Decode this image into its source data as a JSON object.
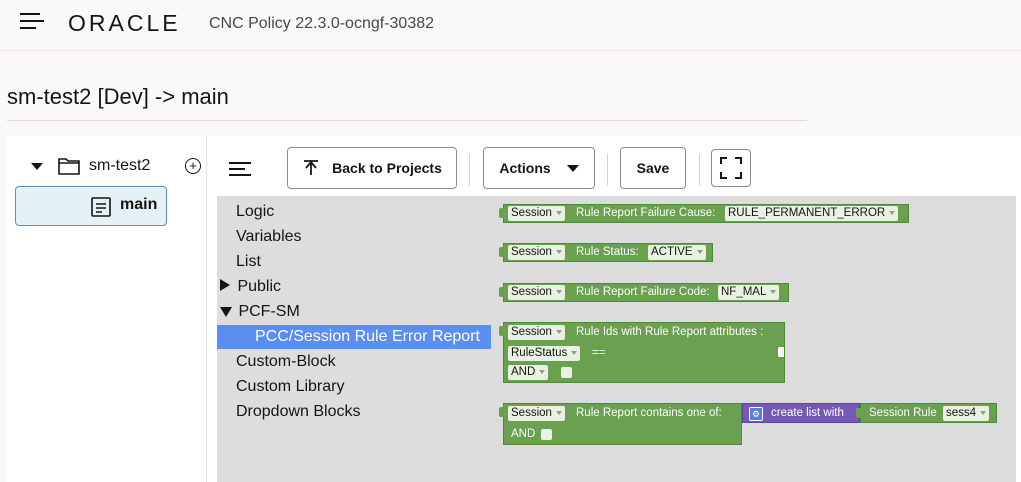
{
  "header": {
    "logo_text": "ORACLE",
    "app_title": "CNC Policy 22.3.0-ocngf-30382"
  },
  "page": {
    "title": "sm-test2 [Dev] -> main"
  },
  "tree": {
    "project": "sm-test2",
    "add_symbol": "+",
    "child": "main"
  },
  "toolbar": {
    "back_label": "Back to Projects",
    "actions_label": "Actions",
    "save_label": "Save"
  },
  "palette": {
    "items": [
      "Logic",
      "Variables",
      "List",
      "Public",
      "PCF-SM",
      "PCC/Session Rule Error Report",
      "Custom-Block",
      "Custom Library",
      "Dropdown Blocks"
    ]
  },
  "blocks": {
    "b1": {
      "session": "Session",
      "label": "Rule Report Failure Cause:",
      "value": "RULE_PERMANENT_ERROR"
    },
    "b2": {
      "session": "Session",
      "label": "Rule Status:",
      "value": "ACTIVE"
    },
    "b3": {
      "session": "Session",
      "label": "Rule Report Failure Code:",
      "value": "NF_MAL"
    },
    "b4": {
      "session": "Session",
      "label": "Rule Ids with Rule Report attributes :",
      "attr": "RuleStatus",
      "op": "==",
      "logic": "AND"
    },
    "b5": {
      "session": "Session",
      "label": "Rule Report contains one of:",
      "logic": "AND",
      "list_label": "create list with",
      "rule_label": "Session Rule",
      "rule_value": "sess4"
    }
  },
  "colors": {
    "block_green": "#6aa04f",
    "list_purple": "#7659b5",
    "selected_blue": "#5b8ef0"
  }
}
